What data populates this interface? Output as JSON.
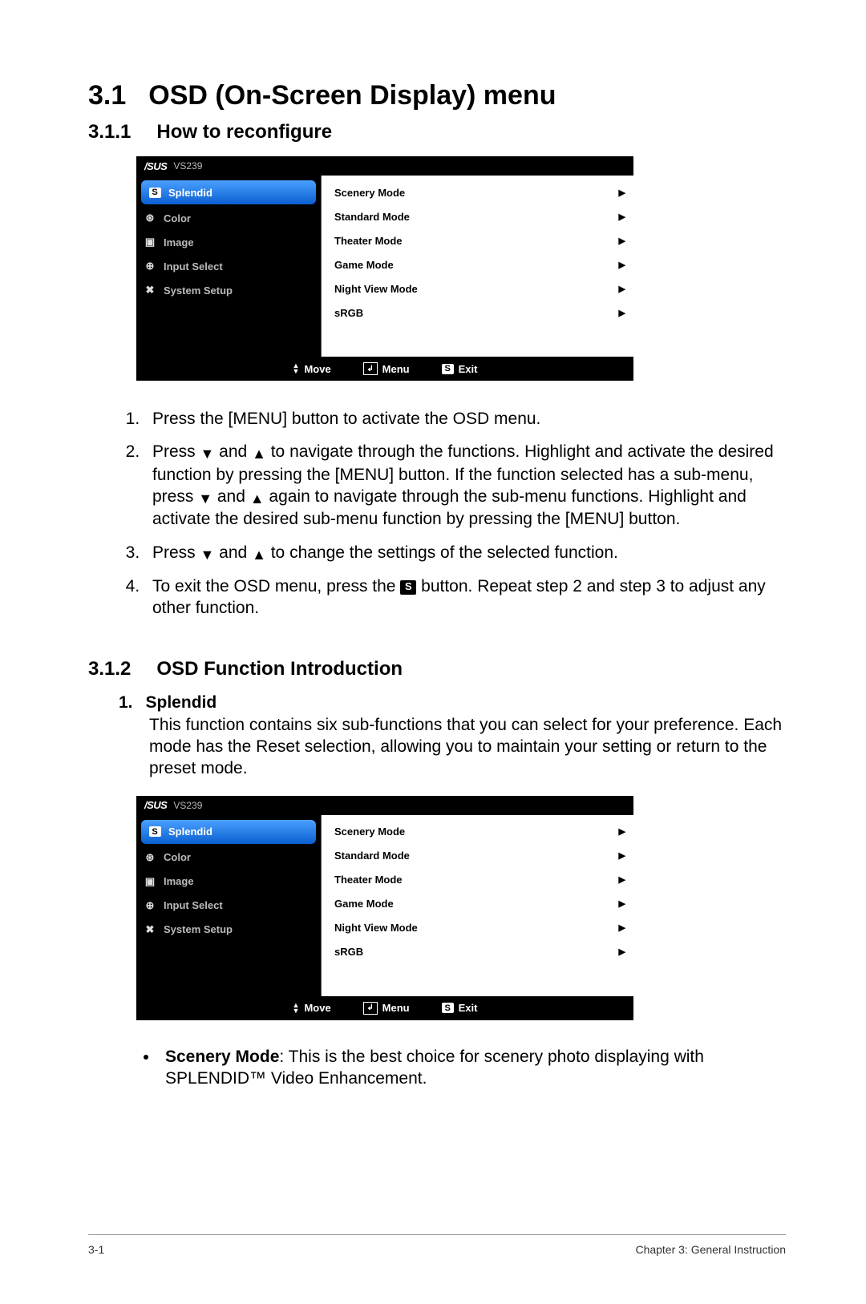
{
  "section": {
    "num": "3.1",
    "title": "OSD (On-Screen Display) menu"
  },
  "sub1": {
    "num": "3.1.1",
    "title": "How to reconfigure"
  },
  "sub2": {
    "num": "3.1.2",
    "title": "OSD Function Introduction"
  },
  "osd": {
    "brand": "/SUS",
    "model": "VS239",
    "left": [
      {
        "label": "Splendid",
        "selected": true,
        "icon": "s"
      },
      {
        "label": "Color",
        "icon": "color"
      },
      {
        "label": "Image",
        "icon": "image"
      },
      {
        "label": "Input Select",
        "icon": "input"
      },
      {
        "label": "System Setup",
        "icon": "setup"
      }
    ],
    "right": [
      "Scenery Mode",
      "Standard Mode",
      "Theater Mode",
      "Game Mode",
      "Night View Mode",
      "sRGB"
    ],
    "bottom": {
      "move": "Move",
      "menu": "Menu",
      "exit": "Exit"
    }
  },
  "steps": {
    "s1": "Press the [MENU] button to activate the OSD menu.",
    "s2a": "Press ",
    "s2b": " and ",
    "s2c": " to navigate through the functions. Highlight and activate the desired function by pressing the [MENU] button. If the function selected has a sub-menu, press ",
    "s2d": " and ",
    "s2e": " again to navigate through the sub-menu functions. Highlight and activate the desired sub-menu function by pressing the [MENU] button.",
    "s3a": "Press ",
    "s3b": " and ",
    "s3c": " to change the settings of the selected function.",
    "s4a": "To exit the OSD menu, press the ",
    "s4b": " button. Repeat step 2 and step 3 to adjust any other function."
  },
  "splendid": {
    "num": "1.",
    "title": "Splendid",
    "body": "This function contains six sub-functions that you can select for your preference. Each mode has the Reset selection, allowing you to maintain your setting or return to the preset mode."
  },
  "bullet1": {
    "bold": "Scenery Mode",
    "rest": ": This is the best choice for scenery photo displaying with SPLENDID™ Video Enhancement."
  },
  "footer": {
    "left": "3-1",
    "right": "Chapter 3: General Instruction"
  },
  "s_letter": "S"
}
